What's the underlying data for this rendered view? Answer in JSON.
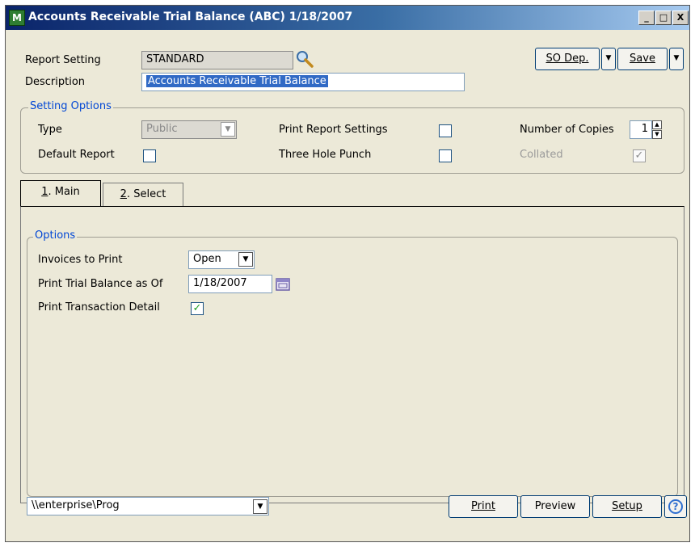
{
  "window": {
    "title": "Accounts Receivable Trial Balance (ABC) 1/18/2007",
    "min_glyph": "_",
    "max_glyph": "□",
    "close_glyph": "X"
  },
  "toolbar": {
    "so_dep_label": "SO Dep.",
    "save_label": "Save"
  },
  "header": {
    "report_setting_label": "Report Setting",
    "report_setting_value": "STANDARD",
    "description_label": "Description",
    "description_value": "Accounts Receivable Trial Balance"
  },
  "setting_options": {
    "title": "Setting Options",
    "type_label": "Type",
    "type_value": "Public",
    "default_report_label": "Default Report",
    "default_report_checked": false,
    "print_report_settings_label": "Print Report Settings",
    "print_report_settings_checked": false,
    "three_hole_punch_label": "Three Hole Punch",
    "three_hole_punch_checked": false,
    "number_of_copies_label": "Number of Copies",
    "number_of_copies_value": "1",
    "collated_label": "Collated",
    "collated_mark": "✓"
  },
  "tabs": [
    {
      "key": "1",
      "rest": ". Main"
    },
    {
      "key": "2",
      "rest": ". Select"
    }
  ],
  "options": {
    "title": "Options",
    "invoices_to_print_label": "Invoices to Print",
    "invoices_to_print_value": "Open",
    "print_trial_balance_label": "Print Trial Balance as Of",
    "print_trial_balance_value": "1/18/2007",
    "print_transaction_detail_label": "Print Transaction Detail",
    "print_transaction_detail_mark": "✓"
  },
  "footer": {
    "printer_value": "\\\\enterprise\\Prog",
    "print_label": "Print",
    "preview_label": "Preview",
    "setup_label": "Setup",
    "help_glyph": "?"
  },
  "colors": {
    "accent": "#0046d5",
    "check": "#21a121"
  }
}
